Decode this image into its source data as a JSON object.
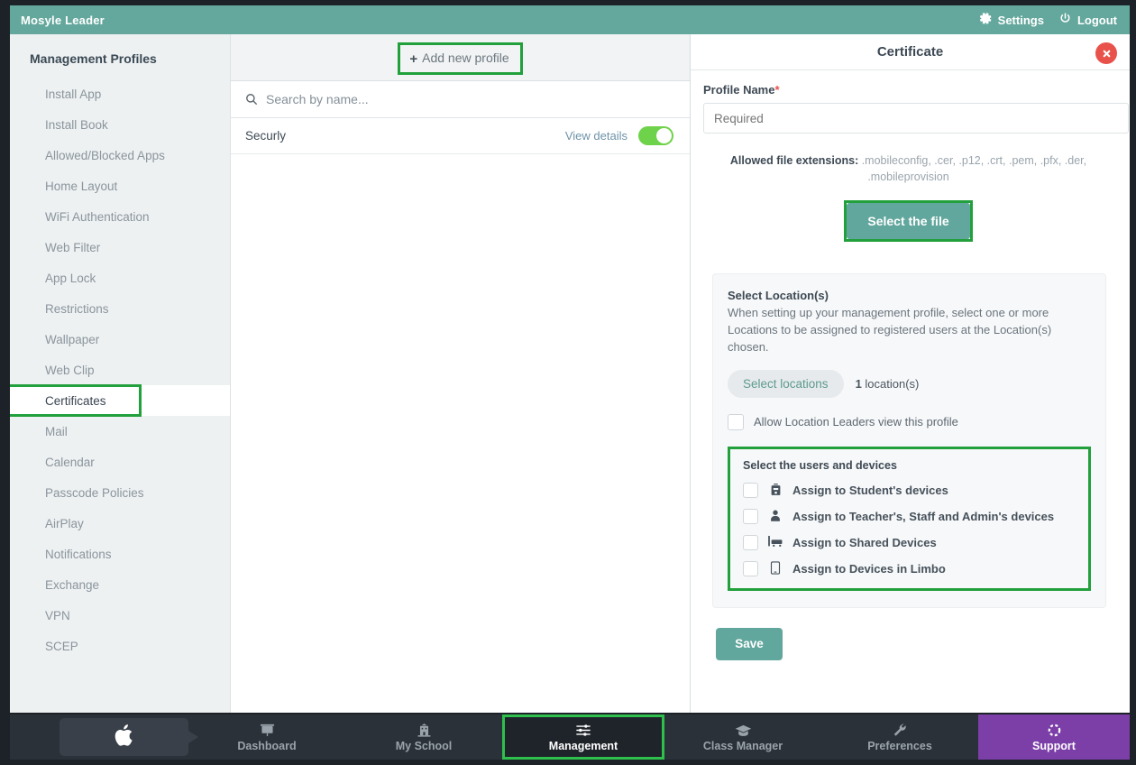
{
  "topbar": {
    "brand": "Mosyle Leader",
    "settings_label": "Settings",
    "logout_label": "Logout"
  },
  "sidebar": {
    "title": "Management Profiles",
    "items": [
      {
        "label": "Install App",
        "active": false
      },
      {
        "label": "Install Book",
        "active": false
      },
      {
        "label": "Allowed/Blocked Apps",
        "active": false
      },
      {
        "label": "Home Layout",
        "active": false
      },
      {
        "label": "WiFi Authentication",
        "active": false
      },
      {
        "label": "Web Filter",
        "active": false
      },
      {
        "label": "App Lock",
        "active": false
      },
      {
        "label": "Restrictions",
        "active": false
      },
      {
        "label": "Wallpaper",
        "active": false
      },
      {
        "label": "Web Clip",
        "active": false
      },
      {
        "label": "Certificates",
        "active": true
      },
      {
        "label": "Mail",
        "active": false
      },
      {
        "label": "Calendar",
        "active": false
      },
      {
        "label": "Passcode Policies",
        "active": false
      },
      {
        "label": "AirPlay",
        "active": false
      },
      {
        "label": "Notifications",
        "active": false
      },
      {
        "label": "Exchange",
        "active": false
      },
      {
        "label": "VPN",
        "active": false
      },
      {
        "label": "SCEP",
        "active": false
      }
    ]
  },
  "list_panel": {
    "add_profile_label": "Add new profile",
    "add_profile_plus": "+",
    "search_placeholder": "Search by name...",
    "rows": [
      {
        "name": "Securly",
        "details_label": "View details",
        "enabled": true
      }
    ]
  },
  "detail_panel": {
    "title": "Certificate",
    "profile_name_label": "Profile Name",
    "required_marker": "*",
    "profile_name_placeholder": "Required",
    "profile_name_value": "",
    "extensions_prefix": "Allowed file extensions:",
    "extensions_list": " .mobileconfig, .cer, .p12, .crt, .pem, .pfx, .der, .mobileprovision",
    "select_file_label": "Select the file",
    "location": {
      "title": "Select Location(s)",
      "description": "When setting up your management profile, select one or more Locations to be assigned to registered users at the Location(s) chosen.",
      "select_locations_label": "Select locations",
      "count_number": "1",
      "count_suffix": " location(s)",
      "allow_leaders_label": "Allow Location Leaders view this profile",
      "allow_leaders_checked": false
    },
    "users_devices": {
      "title": "Select the users and devices",
      "options": [
        {
          "label": "Assign to Student's devices",
          "icon": "backpack-icon",
          "glyph": "🎒",
          "checked": false
        },
        {
          "label": "Assign to Teacher's, Staff and Admin's devices",
          "icon": "person-icon",
          "glyph": "👤",
          "checked": false
        },
        {
          "label": "Assign to Shared Devices",
          "icon": "cart-icon",
          "glyph": "🛒",
          "checked": false
        },
        {
          "label": "Assign to Devices in Limbo",
          "icon": "tablet-icon",
          "glyph": "▯",
          "checked": false
        }
      ]
    },
    "save_label": "Save"
  },
  "bottom_nav": {
    "items": [
      {
        "label": "Dashboard",
        "icon": "presentation-icon",
        "active": false
      },
      {
        "label": "My School",
        "icon": "school-icon",
        "active": false
      },
      {
        "label": "Management",
        "icon": "sliders-icon",
        "active": true
      },
      {
        "label": "Class Manager",
        "icon": "graduation-cap-icon",
        "active": false
      },
      {
        "label": "Preferences",
        "icon": "wrench-icon",
        "active": false
      },
      {
        "label": "Support",
        "icon": "lifebuoy-icon",
        "active": false,
        "highlight": true
      }
    ]
  },
  "colors": {
    "header_teal": "#64a89d",
    "accent_teal": "#62a79d",
    "highlight_green": "#22a03c",
    "toggle_green": "#6fd24b",
    "close_red": "#e8524b",
    "support_purple": "#7c3fa8",
    "nav_dark": "#2b3138"
  }
}
